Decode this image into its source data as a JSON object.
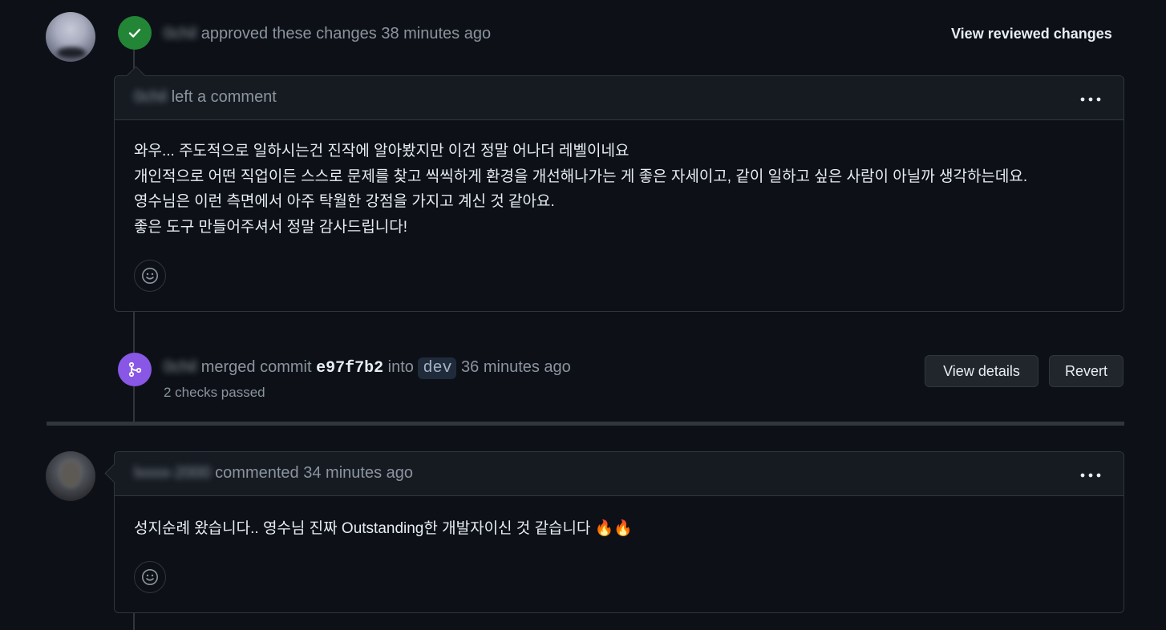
{
  "review": {
    "user": "0chil",
    "action": "approved these changes",
    "time": "38 minutes ago",
    "view_reviewed_label": "View reviewed changes"
  },
  "review_comment": {
    "user": "0chil",
    "action": "left a comment",
    "lines": [
      "와우... 주도적으로 일하시는건 진작에 알아봤지만 이건 정말 어나더 레벨이네요",
      "개인적으로 어떤 직업이든 스스로 문제를 찾고 씩씩하게 환경을 개선해나가는 게 좋은 자세이고, 같이 일하고 싶은 사람이 아닐까 생각하는데요.",
      "영수님은 이런 측면에서 아주 탁월한 강점을 가지고 계신 것 같아요.",
      "좋은 도구 만들어주셔서 정말 감사드립니다!"
    ],
    "menu_icon": "kebab-horizontal-icon",
    "reaction_icon": "smiley-icon"
  },
  "merge": {
    "user": "0chil",
    "action": "merged commit",
    "commit": "e97f7b2",
    "into": "into",
    "branch": "dev",
    "time": "36 minutes ago",
    "checks": "2 checks passed",
    "view_details_label": "View details",
    "revert_label": "Revert"
  },
  "comment2": {
    "user": "lxxxx-2000",
    "action": "commented",
    "time": "34 minutes ago",
    "text": "성지순례 왔습니다.. 영수님 진짜 Outstanding한 개발자이신 것 같습니다 🔥🔥",
    "menu_icon": "kebab-horizontal-icon",
    "reaction_icon": "smiley-icon"
  },
  "colors": {
    "background": "#0d1117",
    "approved_green": "#238636",
    "merged_purple": "#8957e5",
    "border": "#30363d"
  }
}
